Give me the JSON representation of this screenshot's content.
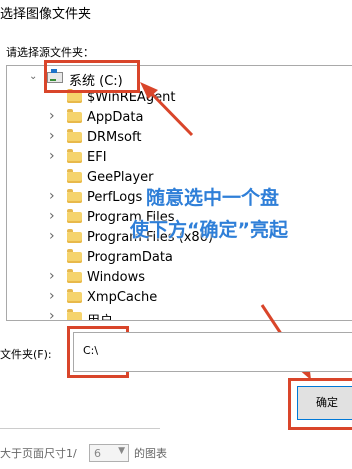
{
  "window": {
    "title": "选择图像文件夹"
  },
  "prompt_label": "请选择源文件夹：",
  "tree": {
    "root": {
      "label": "系统 (C:)",
      "expanded": true,
      "selected": true
    },
    "items": [
      {
        "label": "$WinREAgent",
        "has_children": false
      },
      {
        "label": "AppData",
        "has_children": true
      },
      {
        "label": "DRMsoft",
        "has_children": true
      },
      {
        "label": "EFI",
        "has_children": true
      },
      {
        "label": "GeePlayer",
        "has_children": false
      },
      {
        "label": "PerfLogs",
        "has_children": true
      },
      {
        "label": "Program Files",
        "has_children": true
      },
      {
        "label": "Program Files (x86)",
        "has_children": true
      },
      {
        "label": "ProgramData",
        "has_children": false
      },
      {
        "label": "Windows",
        "has_children": true
      },
      {
        "label": "XmpCache",
        "has_children": true
      },
      {
        "label": "用户",
        "has_children": true
      }
    ]
  },
  "annotation": {
    "line1": "随意选中一个盘",
    "line2": "使下方“确定”亮起",
    "color": "#2f7fd8"
  },
  "folder_field": {
    "label": "文件夹(F):",
    "value": "C:\\"
  },
  "ok_button": {
    "label": "确定"
  },
  "bottom": {
    "prefix": "大于页面尺寸1/",
    "spin_value": "6",
    "suffix": "的图表"
  },
  "colors": {
    "highlight": "#d9452a",
    "folder": "#f5d36c"
  }
}
